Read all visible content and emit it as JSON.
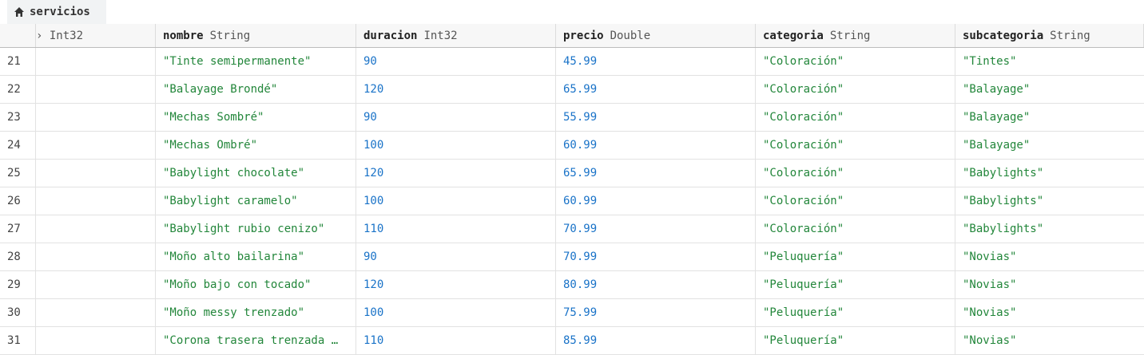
{
  "tab": {
    "icon": "home-icon",
    "label": "servicios"
  },
  "columns": [
    {
      "name": "",
      "type": "› Int32"
    },
    {
      "name": "nombre",
      "type": "String"
    },
    {
      "name": "duracion",
      "type": "Int32"
    },
    {
      "name": "precio",
      "type": "Double"
    },
    {
      "name": "categoria",
      "type": "String"
    },
    {
      "name": "subcategoria",
      "type": "String"
    }
  ],
  "rows": [
    {
      "idx": "21",
      "nombre": "\"Tinte semipermanente\"",
      "duracion": "90",
      "precio": "45.99",
      "categoria": "\"Coloración\"",
      "subcategoria": "\"Tintes\""
    },
    {
      "idx": "22",
      "nombre": "\"Balayage Brondé\"",
      "duracion": "120",
      "precio": "65.99",
      "categoria": "\"Coloración\"",
      "subcategoria": "\"Balayage\""
    },
    {
      "idx": "23",
      "nombre": "\"Mechas Sombré\"",
      "duracion": "90",
      "precio": "55.99",
      "categoria": "\"Coloración\"",
      "subcategoria": "\"Balayage\""
    },
    {
      "idx": "24",
      "nombre": "\"Mechas Ombré\"",
      "duracion": "100",
      "precio": "60.99",
      "categoria": "\"Coloración\"",
      "subcategoria": "\"Balayage\""
    },
    {
      "idx": "25",
      "nombre": "\"Babylight chocolate\"",
      "duracion": "120",
      "precio": "65.99",
      "categoria": "\"Coloración\"",
      "subcategoria": "\"Babylights\""
    },
    {
      "idx": "26",
      "nombre": "\"Babylight caramelo\"",
      "duracion": "100",
      "precio": "60.99",
      "categoria": "\"Coloración\"",
      "subcategoria": "\"Babylights\""
    },
    {
      "idx": "27",
      "nombre": "\"Babylight rubio cenizo\"",
      "duracion": "110",
      "precio": "70.99",
      "categoria": "\"Coloración\"",
      "subcategoria": "\"Babylights\""
    },
    {
      "idx": "28",
      "nombre": "\"Moño alto bailarina\"",
      "duracion": "90",
      "precio": "70.99",
      "categoria": "\"Peluquería\"",
      "subcategoria": "\"Novias\""
    },
    {
      "idx": "29",
      "nombre": "\"Moño bajo con tocado\"",
      "duracion": "120",
      "precio": "80.99",
      "categoria": "\"Peluquería\"",
      "subcategoria": "\"Novias\""
    },
    {
      "idx": "30",
      "nombre": "\"Moño messy trenzado\"",
      "duracion": "100",
      "precio": "75.99",
      "categoria": "\"Peluquería\"",
      "subcategoria": "\"Novias\""
    },
    {
      "idx": "31",
      "nombre": "\"Corona trasera trenzada …",
      "duracion": "110",
      "precio": "85.99",
      "categoria": "\"Peluquería\"",
      "subcategoria": "\"Novias\""
    }
  ],
  "colors": {
    "string": "#22863a",
    "number": "#1a73c8"
  }
}
